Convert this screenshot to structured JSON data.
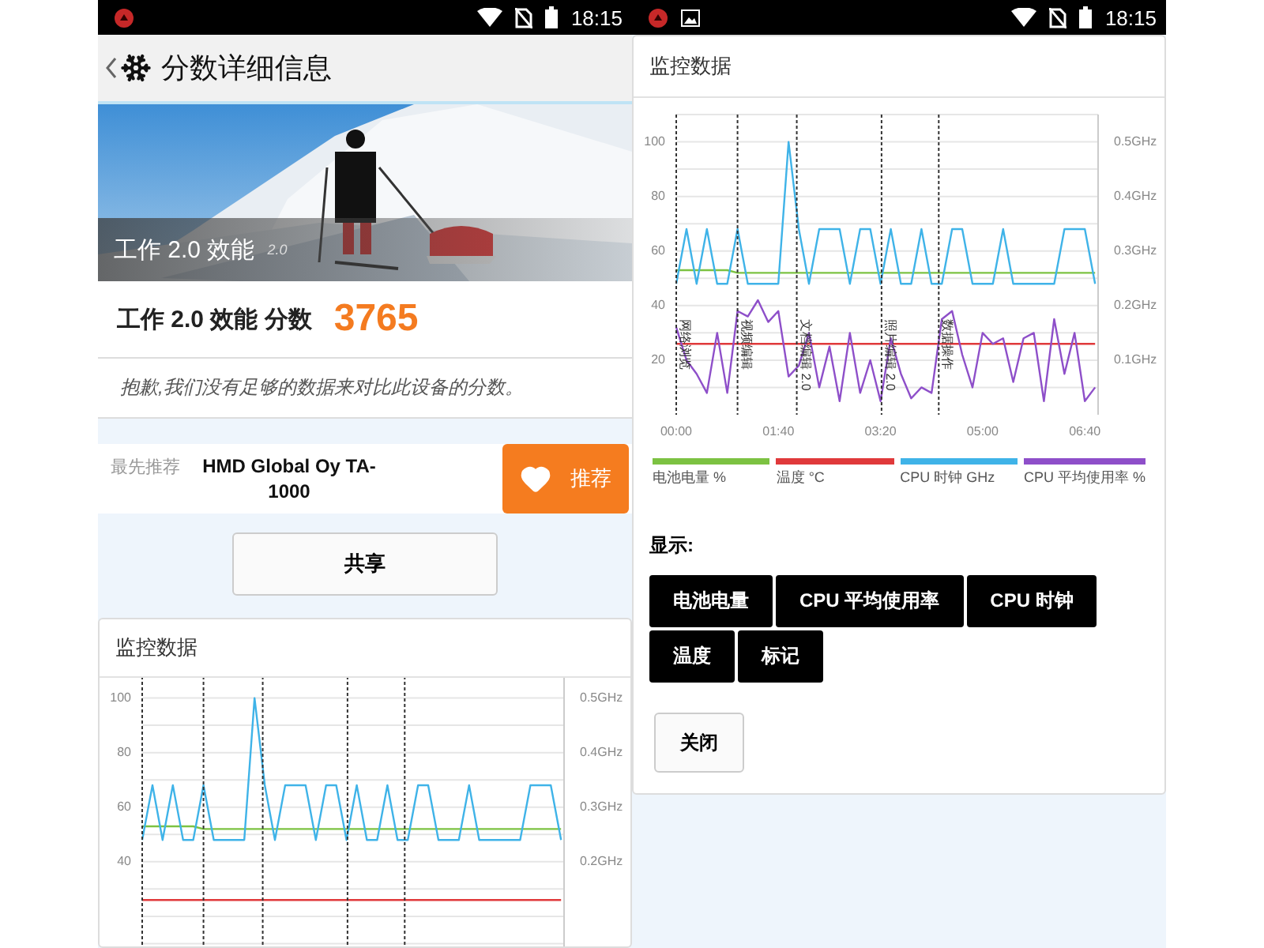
{
  "left_screen": {
    "status_bar": {
      "time": "18:15"
    },
    "header": {
      "title": "分数详细信息"
    },
    "hero": {
      "kind": "picture",
      "caption": "工作 2.0 效能",
      "version": "2.0"
    },
    "score": {
      "label": "工作 2.0 效能 分数",
      "value": "3765"
    },
    "note": "抱歉,我们没有足够的数据来对比此设备的分数。",
    "recommend": {
      "prefix": "最先推荐",
      "device": "HMD Global Oy TA-1000",
      "button": "推荐"
    },
    "share_button": "共享",
    "monitor": {
      "title": "监控数据",
      "chart_data": {
        "type": "line",
        "categories": [
          null,
          null,
          null,
          null,
          null,
          null,
          null,
          null,
          null,
          null,
          null,
          null,
          null,
          null,
          null,
          null,
          null,
          null,
          null,
          null,
          null,
          null,
          null,
          null,
          null,
          null,
          null,
          null,
          null,
          null,
          null,
          null,
          null,
          null,
          null,
          null,
          null,
          null,
          null,
          null,
          null,
          null
        ],
        "ylim": [
          0,
          110
        ],
        "y2lim": [
          0,
          0.55
        ],
        "grid": true,
        "yticks": [
          40,
          60,
          80,
          100
        ],
        "y2ticks": [
          {
            "value": 0.2,
            "label": "0.2GHz"
          },
          {
            "value": 0.3,
            "label": "0.3GHz"
          },
          {
            "value": 0.4,
            "label": "0.4GHz"
          },
          {
            "value": 0.5,
            "label": "0.5GHz"
          }
        ],
        "series": [
          {
            "color": "#7cc242",
            "values": [
              53,
              53,
              53,
              53,
              53,
              53,
              52,
              52,
              52,
              52,
              52,
              52,
              52,
              52,
              52,
              52,
              52,
              52,
              52,
              52,
              52,
              52,
              52,
              52,
              52,
              52,
              52,
              52,
              52,
              52,
              52,
              52,
              52,
              52,
              52,
              52,
              52,
              52,
              52,
              52,
              52,
              52
            ]
          },
          {
            "color": "#e0393b",
            "values": [
              26,
              26,
              26,
              26,
              26,
              26,
              26,
              26,
              26,
              26,
              26,
              26,
              26,
              26,
              26,
              26,
              26,
              26,
              26,
              26,
              26,
              26,
              26,
              26,
              26,
              26,
              26,
              26,
              26,
              26,
              26,
              26,
              26,
              26,
              26,
              26,
              26,
              26,
              26,
              26,
              26,
              26
            ]
          },
          {
            "color": "#3fb3e8",
            "axis": "y2",
            "values": [
              0.24,
              0.34,
              0.24,
              0.34,
              0.24,
              0.24,
              0.34,
              0.24,
              0.24,
              0.24,
              0.24,
              0.5,
              0.34,
              0.24,
              0.34,
              0.34,
              0.34,
              0.24,
              0.34,
              0.34,
              0.24,
              0.34,
              0.24,
              0.24,
              0.34,
              0.24,
              0.24,
              0.34,
              0.34,
              0.24,
              0.24,
              0.24,
              0.34,
              0.24,
              0.24,
              0.24,
              0.24,
              0.24,
              0.34,
              0.34,
              0.34,
              0.24
            ]
          }
        ]
      }
    }
  },
  "right_screen": {
    "status_bar": {
      "time": "18:15"
    },
    "monitor": {
      "title": "监控数据",
      "chart_data": {
        "type": "line",
        "x": [
          0,
          10,
          20,
          30,
          40,
          50,
          60,
          70,
          80,
          90,
          100,
          110,
          120,
          130,
          140,
          150,
          160,
          170,
          180,
          190,
          200,
          210,
          220,
          230,
          240,
          250,
          260,
          270,
          280,
          290,
          300,
          310,
          320,
          330,
          340,
          350,
          360,
          370,
          380,
          390,
          400,
          410
        ],
        "xlim": [
          0,
          413
        ],
        "ylim": [
          0,
          110
        ],
        "y2lim": [
          0,
          0.55
        ],
        "grid": true,
        "xticks": [
          {
            "value": 0,
            "label": "00:00"
          },
          {
            "value": 100,
            "label": "01:40"
          },
          {
            "value": 200,
            "label": "03:20"
          },
          {
            "value": 300,
            "label": "05:00"
          },
          {
            "value": 400,
            "label": "06:40"
          }
        ],
        "yticks": [
          20,
          40,
          60,
          80,
          100
        ],
        "y2ticks": [
          {
            "value": 0.1,
            "label": "0.1GHz"
          },
          {
            "value": 0.2,
            "label": "0.2GHz"
          },
          {
            "value": 0.3,
            "label": "0.3GHz"
          },
          {
            "value": 0.4,
            "label": "0.4GHz"
          },
          {
            "value": 0.5,
            "label": "0.5GHz"
          }
        ],
        "series": [
          {
            "name": "电池电量 %",
            "color": "#7cc242",
            "values": [
              53,
              53,
              53,
              53,
              53,
              53,
              52,
              52,
              52,
              52,
              52,
              52,
              52,
              52,
              52,
              52,
              52,
              52,
              52,
              52,
              52,
              52,
              52,
              52,
              52,
              52,
              52,
              52,
              52,
              52,
              52,
              52,
              52,
              52,
              52,
              52,
              52,
              52,
              52,
              52,
              52,
              52
            ]
          },
          {
            "name": "温度 °C",
            "color": "#e0393b",
            "values": [
              26,
              26,
              26,
              26,
              26,
              26,
              26,
              26,
              26,
              26,
              26,
              26,
              26,
              26,
              26,
              26,
              26,
              26,
              26,
              26,
              26,
              26,
              26,
              26,
              26,
              26,
              26,
              26,
              26,
              26,
              26,
              26,
              26,
              26,
              26,
              26,
              26,
              26,
              26,
              26,
              26,
              26
            ]
          },
          {
            "name": "CPU 时钟 GHz",
            "color": "#3fb3e8",
            "axis": "y2",
            "values": [
              0.24,
              0.34,
              0.24,
              0.34,
              0.24,
              0.24,
              0.34,
              0.24,
              0.24,
              0.24,
              0.24,
              0.5,
              0.34,
              0.24,
              0.34,
              0.34,
              0.34,
              0.24,
              0.34,
              0.34,
              0.24,
              0.34,
              0.24,
              0.24,
              0.34,
              0.24,
              0.24,
              0.34,
              0.34,
              0.24,
              0.24,
              0.24,
              0.34,
              0.24,
              0.24,
              0.24,
              0.24,
              0.24,
              0.34,
              0.34,
              0.34,
              0.24
            ]
          },
          {
            "name": "CPU 平均使用率 %",
            "color": "#8e4fc9",
            "values": [
              32,
              20,
              15,
              8,
              30,
              8,
              38,
              36,
              42,
              34,
              38,
              14,
              18,
              30,
              10,
              25,
              5,
              30,
              8,
              20,
              5,
              28,
              15,
              6,
              10,
              8,
              35,
              38,
              22,
              10,
              30,
              26,
              28,
              12,
              28,
              30,
              5,
              35,
              15,
              30,
              5,
              10
            ]
          }
        ],
        "annotations": [
          {
            "x": 0,
            "text": "网络浏览"
          },
          {
            "x": 60,
            "text": "视频编辑"
          },
          {
            "x": 118,
            "text": "文档编辑 2.0"
          },
          {
            "x": 201,
            "text": "照片编辑 2.0"
          },
          {
            "x": 257,
            "text": "数据操作"
          }
        ]
      }
    },
    "show_label": "显示:",
    "toggles": [
      "电池电量",
      "CPU 平均使用率",
      "CPU 时钟",
      "温度",
      "标记"
    ],
    "close_button": "关闭"
  }
}
